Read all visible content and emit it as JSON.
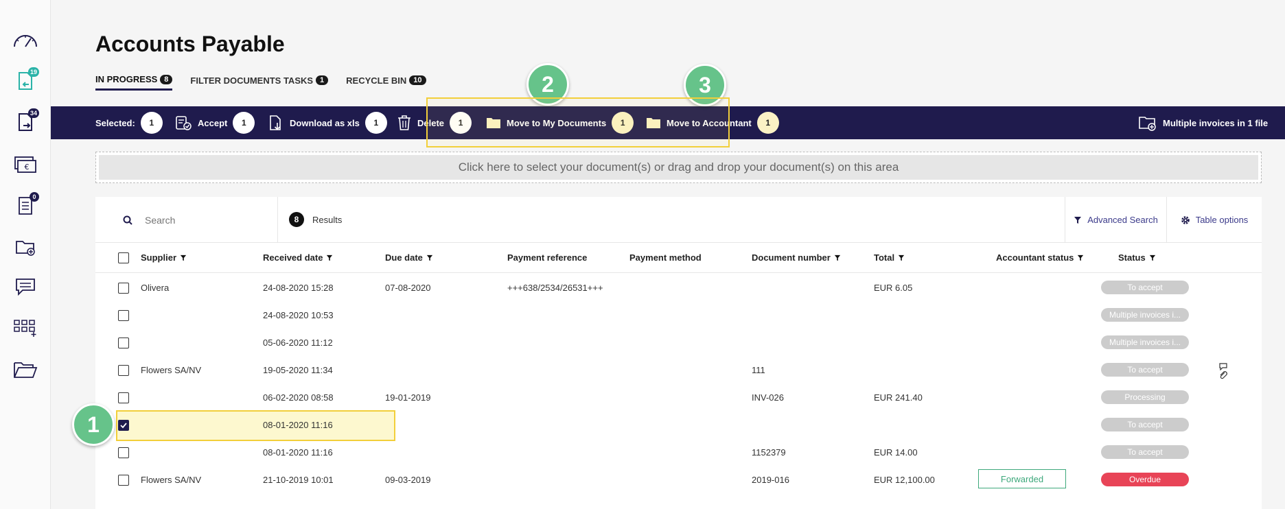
{
  "sidebar": {
    "items": [
      {
        "icon": "dashboard-gauge-icon"
      },
      {
        "icon": "incoming-document-icon",
        "badge": "19"
      },
      {
        "icon": "outgoing-document-icon",
        "badge": "34"
      },
      {
        "icon": "euro-payment-icon"
      },
      {
        "icon": "checklist-document-icon",
        "badge": "0"
      },
      {
        "icon": "add-folder-icon"
      },
      {
        "icon": "message-icon"
      },
      {
        "icon": "apps-grid-add-icon"
      },
      {
        "icon": "open-folder-icon"
      }
    ]
  },
  "page": {
    "title": "Accounts Payable"
  },
  "tabs": [
    {
      "label": "IN PROGRESS",
      "count": "8",
      "active": true
    },
    {
      "label": "FILTER DOCUMENTS TASKS",
      "count": "1"
    },
    {
      "label": "RECYCLE BIN",
      "count": "10"
    }
  ],
  "toolbar": {
    "selected_label": "Selected:",
    "selected_count": "1",
    "accept_label": "Accept",
    "accept_count": "1",
    "download_label": "Download as xls",
    "download_count": "1",
    "delete_label": "Delete",
    "delete_count": "1",
    "move_docs_label": "Move to My Documents",
    "move_docs_count": "1",
    "move_acc_label": "Move to Accountant",
    "move_acc_count": "1",
    "multiple_label": "Multiple invoices in 1 file"
  },
  "steps": [
    "1",
    "2",
    "3"
  ],
  "dropzone": {
    "text": "Click here to select your document(s) or drag and drop your document(s) on this area"
  },
  "search": {
    "placeholder": "Search",
    "results_count": "8",
    "results_label": "Results",
    "advanced_label": "Advanced Search",
    "table_options_label": "Table options"
  },
  "table": {
    "headers": [
      "Supplier",
      "Received date",
      "Due date",
      "Payment reference",
      "Payment method",
      "Document number",
      "Total",
      "Accountant status",
      "Status"
    ],
    "rows": [
      {
        "supplier": "Olivera",
        "received": "24-08-2020 15:28",
        "due": "07-08-2020",
        "payref": "+++638/2534/26531+++",
        "docnum": "",
        "total": "EUR 6.05",
        "acc": "",
        "status": "To accept",
        "checked": false
      },
      {
        "supplier": "",
        "received": "24-08-2020 10:53",
        "due": "",
        "payref": "",
        "docnum": "",
        "total": "",
        "acc": "",
        "status": "Multiple invoices i...",
        "checked": false
      },
      {
        "supplier": "",
        "received": "05-06-2020 11:12",
        "due": "",
        "payref": "",
        "docnum": "",
        "total": "",
        "acc": "",
        "status": "Multiple invoices i...",
        "checked": false
      },
      {
        "supplier": "Flowers SA/NV",
        "received": "19-05-2020 11:34",
        "due": "",
        "payref": "",
        "docnum": "111",
        "total": "",
        "acc": "",
        "status": "To accept",
        "checked": false
      },
      {
        "supplier": "",
        "received": "06-02-2020 08:58",
        "due": "19-01-2019",
        "payref": "",
        "docnum": "INV-026",
        "total": "EUR 241.40",
        "acc": "",
        "status": "Processing",
        "checked": false
      },
      {
        "supplier": "",
        "received": "08-01-2020 11:16",
        "due": "",
        "payref": "",
        "docnum": "",
        "total": "",
        "acc": "",
        "status": "To accept",
        "checked": true
      },
      {
        "supplier": "",
        "received": "08-01-2020 11:16",
        "due": "",
        "payref": "",
        "docnum": "1152379",
        "total": "EUR 14.00",
        "acc": "",
        "status": "To accept",
        "checked": false
      },
      {
        "supplier": "Flowers SA/NV",
        "received": "21-10-2019 10:01",
        "due": "09-03-2019",
        "payref": "",
        "docnum": "2019-016",
        "total": "EUR 12,100.00",
        "acc": "Forwarded",
        "status": "Overdue",
        "checked": false
      }
    ]
  },
  "colors": {
    "navy": "#1f1b4d",
    "step_green": "#66c38a",
    "highlight_yellow": "#f2cf3a",
    "overdue_red": "#e84457",
    "forwarded_green": "#3da87b"
  }
}
